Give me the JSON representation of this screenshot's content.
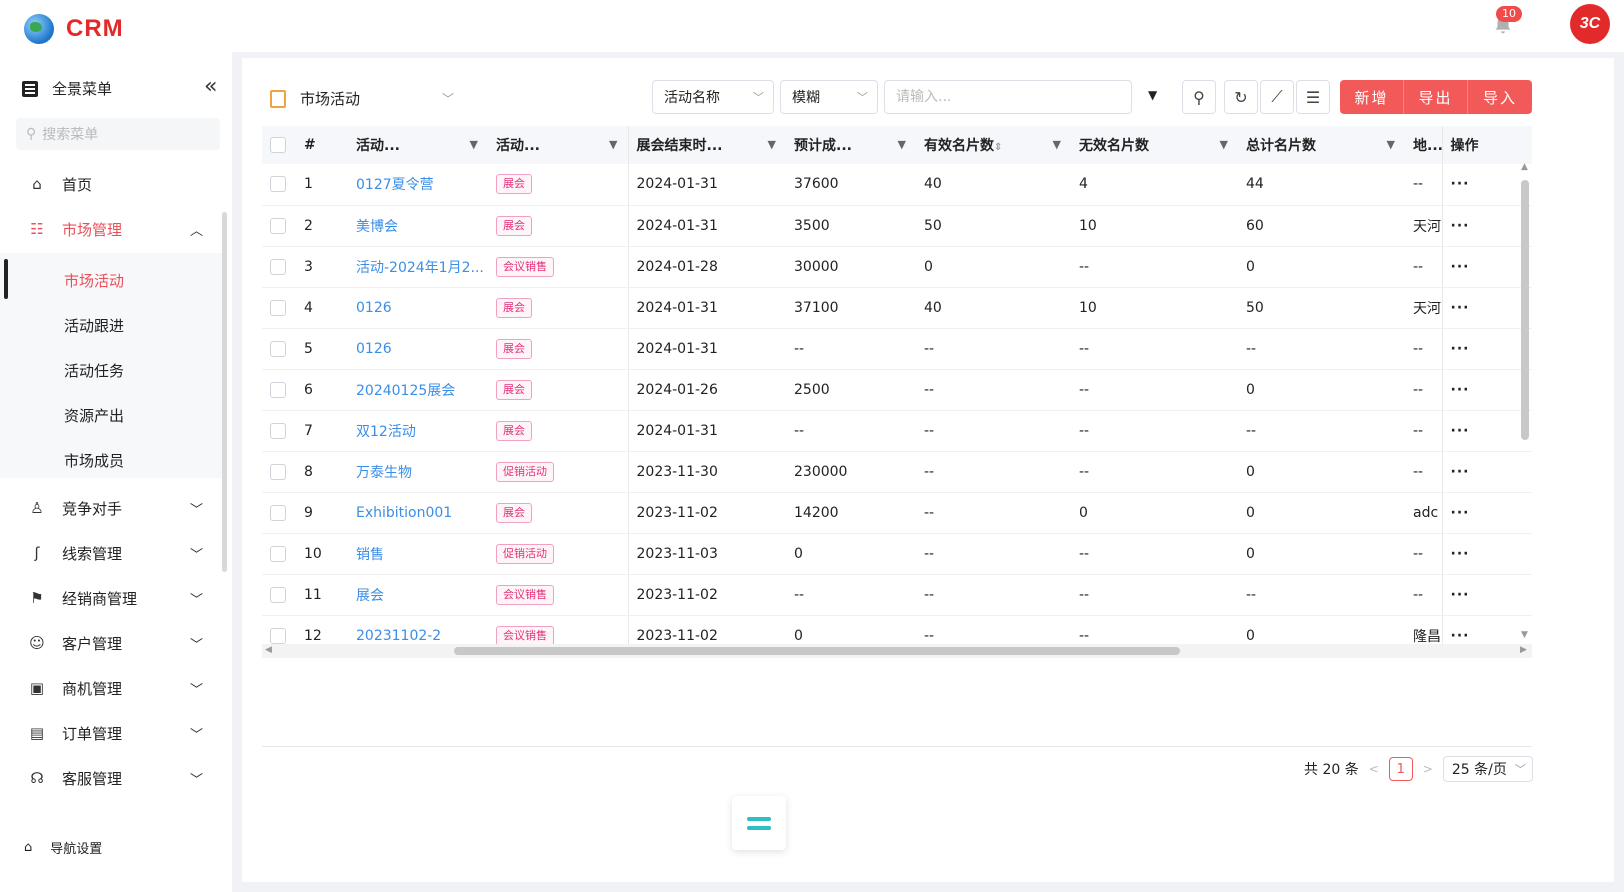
{
  "app": {
    "logo_text": "CRM",
    "notification_count": "10",
    "avatar_text": "3C"
  },
  "sidebar": {
    "menu_title": "全景菜单",
    "search_placeholder": "搜索菜单",
    "items": [
      {
        "label": "首页",
        "icon": "home-icon"
      },
      {
        "label": "市场管理",
        "icon": "market-icon",
        "expanded": true
      },
      {
        "label": "竞争对手",
        "icon": "competitor-icon"
      },
      {
        "label": "线索管理",
        "icon": "clue-icon"
      },
      {
        "label": "经销商管理",
        "icon": "dealer-icon"
      },
      {
        "label": "客户管理",
        "icon": "customer-icon"
      },
      {
        "label": "商机管理",
        "icon": "opportunity-icon"
      },
      {
        "label": "订单管理",
        "icon": "order-icon"
      },
      {
        "label": "客服管理",
        "icon": "headset-icon"
      }
    ],
    "submenu": [
      "市场活动",
      "活动跟进",
      "活动任务",
      "资源产出",
      "市场成员"
    ],
    "nav_setting": "导航设置",
    "accent_color": "#e8505b"
  },
  "toolbar": {
    "view_name": "市场活动",
    "field_select": "活动名称",
    "match_select": "模糊",
    "search_placeholder": "请输入...",
    "buttons": [
      "新增",
      "导出",
      "导入"
    ],
    "button_color": "#f25a5a"
  },
  "table": {
    "columns": [
      "#",
      "活动...",
      "活动...",
      "展会结束时...",
      "预计成...",
      "有效名片数",
      "无效名片数",
      "总计名片数",
      "地...",
      "操作"
    ],
    "rows": [
      [
        "1",
        "0127夏令营",
        "展会",
        "2024-01-31",
        "37600",
        "40",
        "4",
        "44",
        "--"
      ],
      [
        "2",
        "美博会",
        "展会",
        "2024-01-31",
        "3500",
        "50",
        "10",
        "60",
        "天河"
      ],
      [
        "3",
        "活动-2024年1月2...",
        "会议销售",
        "2024-01-28",
        "30000",
        "0",
        "--",
        "0",
        "--"
      ],
      [
        "4",
        "0126",
        "展会",
        "2024-01-31",
        "37100",
        "40",
        "10",
        "50",
        "天河"
      ],
      [
        "5",
        "0126",
        "展会",
        "2024-01-31",
        "--",
        "--",
        "--",
        "--",
        "--"
      ],
      [
        "6",
        "20240125展会",
        "展会",
        "2024-01-26",
        "2500",
        "--",
        "--",
        "0",
        "--"
      ],
      [
        "7",
        "双12活动",
        "展会",
        "2024-01-31",
        "--",
        "--",
        "--",
        "--",
        "--"
      ],
      [
        "8",
        "万泰生物",
        "促销活动",
        "2023-11-30",
        "230000",
        "--",
        "--",
        "0",
        "--"
      ],
      [
        "9",
        "Exhibition001",
        "展会",
        "2023-11-02",
        "14200",
        "--",
        "0",
        "0",
        "adc"
      ],
      [
        "10",
        "销售",
        "促销活动",
        "2023-11-03",
        "0",
        "--",
        "--",
        "0",
        "--"
      ],
      [
        "11",
        "展会",
        "会议销售",
        "2023-11-02",
        "--",
        "--",
        "--",
        "--",
        "--"
      ],
      [
        "12",
        "20231102-2",
        "会议销售",
        "2023-11-02",
        "0",
        "--",
        "--",
        "0",
        "隆昌"
      ]
    ],
    "op_label": "···"
  },
  "pagination": {
    "total": "共 20 条",
    "current_page": "1",
    "page_size": "25 条/页"
  }
}
